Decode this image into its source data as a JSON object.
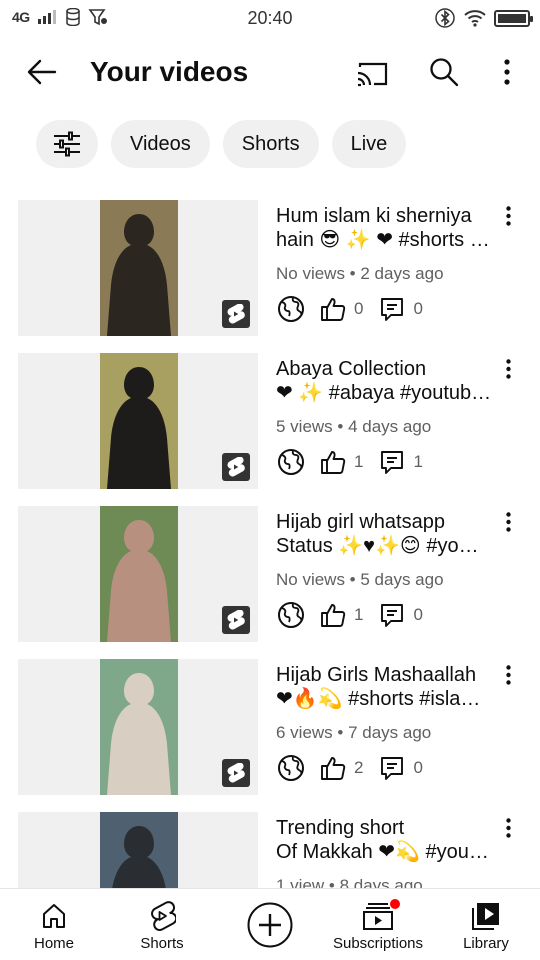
{
  "status_bar": {
    "network": "4G",
    "time": "20:40"
  },
  "header": {
    "title": "Your videos"
  },
  "chips": [
    {
      "label": "Videos"
    },
    {
      "label": "Shorts"
    },
    {
      "label": "Live"
    }
  ],
  "videos": [
    {
      "title_line1": "Hum islam ki sherniya",
      "title_line2": "hain 😎 ✨ ❤ #shorts …",
      "meta": "No views • 2 days ago",
      "likes": "0",
      "comments": "0",
      "thumb_colors": [
        "#8a7a55",
        "#2c2620"
      ]
    },
    {
      "title_line1": "Abaya Collection",
      "title_line2": "❤ ✨ #abaya #youtub…",
      "meta": "5 views • 4 days ago",
      "likes": "1",
      "comments": "1",
      "thumb_colors": [
        "#a8a060",
        "#1e1c1a"
      ]
    },
    {
      "title_line1": "Hijab girl whatsapp",
      "title_line2": "Status ✨♥✨😊 #yo…",
      "meta": "No views • 5 days ago",
      "likes": "1",
      "comments": "0",
      "thumb_colors": [
        "#6e8a55",
        "#b89080"
      ]
    },
    {
      "title_line1": "Hijab Girls Mashaallah",
      "title_line2": "❤🔥💫 #shorts #isla…",
      "meta": "6 views • 7 days ago",
      "likes": "2",
      "comments": "0",
      "thumb_colors": [
        "#7fa88a",
        "#d8cfc2"
      ]
    },
    {
      "title_line1": "Trending short",
      "title_line2": "Of Makkah ❤💫 #you…",
      "meta": "1 view • 8 days ago",
      "likes": "",
      "comments": "",
      "thumb_colors": [
        "#4f6070",
        "#2a2e33"
      ]
    }
  ],
  "bottom_nav": [
    {
      "label": "Home",
      "icon": "home-icon"
    },
    {
      "label": "Shorts",
      "icon": "shorts-icon"
    },
    {
      "label": "",
      "icon": "create-icon"
    },
    {
      "label": "Subscriptions",
      "icon": "subscriptions-icon"
    },
    {
      "label": "Library",
      "icon": "library-icon"
    }
  ]
}
